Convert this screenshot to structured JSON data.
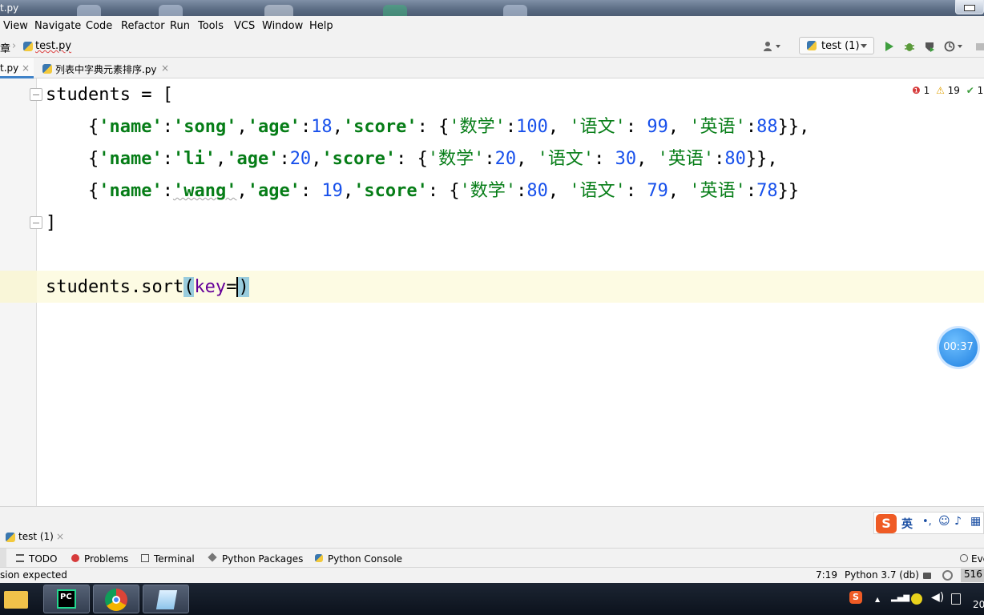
{
  "window": {
    "title": "t.py"
  },
  "menu": [
    "View",
    "Navigate",
    "Code",
    "Refactor",
    "Run",
    "Tools",
    "VCS",
    "Window",
    "Help"
  ],
  "breadcrumb": {
    "project": "章",
    "file": "test.py"
  },
  "run_config": {
    "label": "test (1)"
  },
  "tabs": [
    {
      "label": "t.py",
      "active": true
    },
    {
      "label": "列表中字典元素排序.py",
      "active": false
    }
  ],
  "inspection": {
    "errors": "1",
    "warnings": "19",
    "ok": "1"
  },
  "code": {
    "l1": {
      "name": "students",
      "rest": " = ["
    },
    "l2": {
      "k_name": "'name'",
      "v_name": "'song'",
      "k_age": "'age'",
      "v_age": "18",
      "k_score": "'score'",
      "k_math": "'数学'",
      "v_math": "100",
      "k_chinese": "'语文'",
      "v_chinese": "99",
      "k_english": "'英语'",
      "v_english": "88"
    },
    "l3": {
      "k_name": "'name'",
      "v_name": "'li'",
      "k_age": "'age'",
      "v_age": "20",
      "k_score": "'score'",
      "k_math": "'数学'",
      "v_math": "20",
      "k_chinese": "'语文'",
      "v_chinese": "30",
      "k_english": "'英语'",
      "v_english": "80"
    },
    "l4": {
      "k_name": "'name'",
      "v_name": "'wang'",
      "k_age": "'age'",
      "v_age": "19",
      "k_score": "'score'",
      "k_math": "'数学'",
      "v_math": "80",
      "k_chinese": "'语文'",
      "v_chinese": "79",
      "k_english": "'英语'",
      "v_english": "78"
    },
    "l5": "]",
    "l7": {
      "obj": "students.sort",
      "param": "key"
    }
  },
  "timer": "00:37",
  "run_tab": {
    "label": "test (1)"
  },
  "ime": {
    "logo": "S",
    "lang": "英"
  },
  "tool_windows": [
    "TODO",
    "Problems",
    "Terminal",
    "Python Packages",
    "Python Console"
  ],
  "event_log": "Eve",
  "status": {
    "message": "sion expected",
    "position": "7:19",
    "interpreter": "Python 3.7 (db)",
    "memory": "516"
  },
  "taskbar": {
    "clock": "20",
    "pycharm_label": "PC"
  },
  "colors": {
    "keyword_string": "#067d17",
    "number": "#1750eb",
    "param": "#660099",
    "tab_underline": "#4083c9"
  }
}
